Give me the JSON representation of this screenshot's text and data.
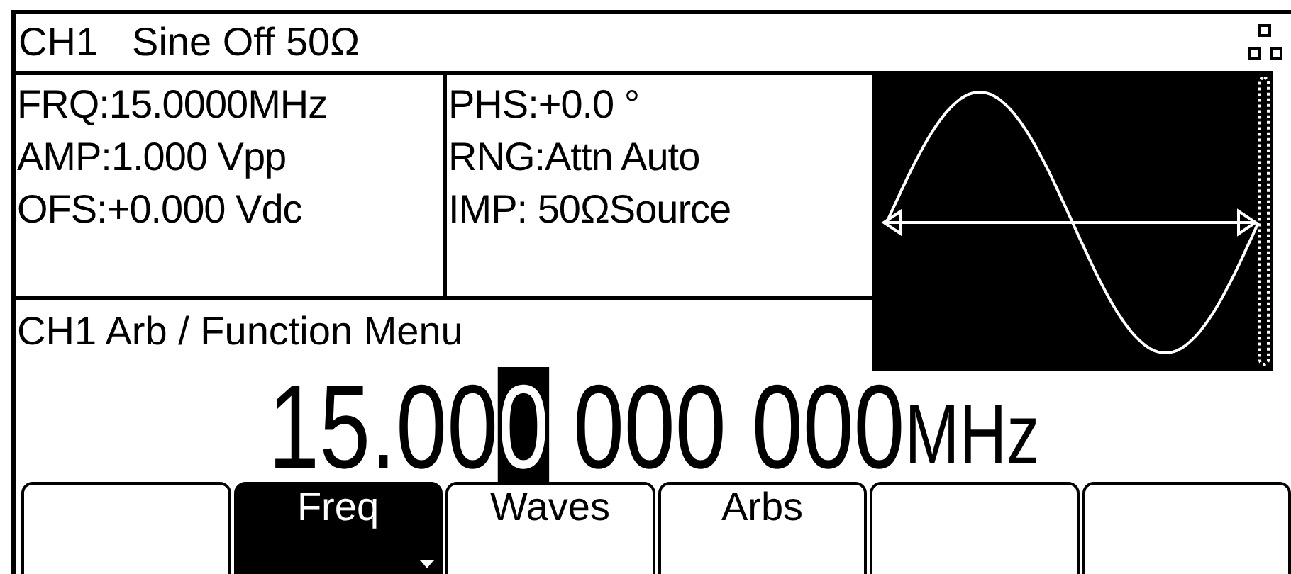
{
  "status_bar": {
    "channel": "CH1",
    "status": "Sine Off 50Ω"
  },
  "parameters": {
    "column_1": [
      "FRQ:15.0000MHz",
      "AMP:1.000 Vpp",
      "OFS:+0.000 Vdc"
    ],
    "column_2": [
      "PHS:+0.0 °",
      "RNG:Attn Auto",
      "IMP: 50ΩSource"
    ]
  },
  "menu_title": "CH1 Arb / Function Menu",
  "readout": [
    {
      "text": "15.00",
      "selected": false
    },
    {
      "text": "0",
      "selected": true
    },
    {
      "text": "000 000",
      "selected": false
    },
    {
      "text": "MHz",
      "selected": false
    }
  ],
  "softkeys": [
    {
      "selected": false
    },
    {
      "label": "Freq",
      "selected": true
    },
    {
      "label": "Waves",
      "selected": false
    },
    {
      "label": "Arbs",
      "selected": false
    },
    {
      "selected": false
    },
    {
      "selected": false
    }
  ]
}
